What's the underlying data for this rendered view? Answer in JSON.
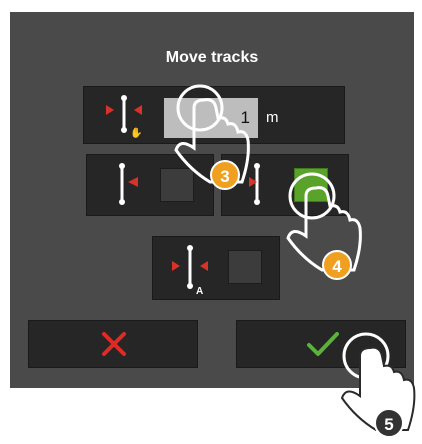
{
  "dialog": {
    "title": "Move tracks",
    "offset": {
      "value": "1",
      "unit": "m"
    },
    "buttons": {
      "cancel_icon": "x-icon",
      "confirm_icon": "check-icon"
    }
  },
  "hints": [
    {
      "step": "3"
    },
    {
      "step": "4"
    },
    {
      "step": "5"
    }
  ],
  "colors": {
    "dialog_bg": "#4a4a4a",
    "button_bg": "#262626",
    "arrow_red": "#d8322b",
    "cancel_red": "#e02a26",
    "confirm_green": "#5bb13a",
    "checkbox_on": "#59a32b",
    "badge_orange": "#f0a020"
  }
}
